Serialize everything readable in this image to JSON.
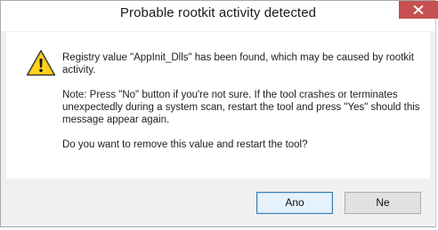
{
  "window": {
    "title": "Probable rootkit activity detected",
    "close_icon": "close-icon"
  },
  "message": {
    "icon": "warning-icon",
    "line1": "Registry value \"AppInit_Dlls\" has been found, which may be caused by rootkit activity.",
    "line2": "Note: Press \"No\" button if you're not sure. If the tool crashes or terminates unexpectedly during a system scan, restart the tool and press \"Yes\" should this message appear again.",
    "line3": "Do you want to remove this value and restart the tool?"
  },
  "buttons": {
    "yes_label": "Ano",
    "no_label": "Ne"
  },
  "colors": {
    "close_button": "#c75050",
    "warning_fill": "#f5c400",
    "default_button_border": "#3c7fb1"
  }
}
